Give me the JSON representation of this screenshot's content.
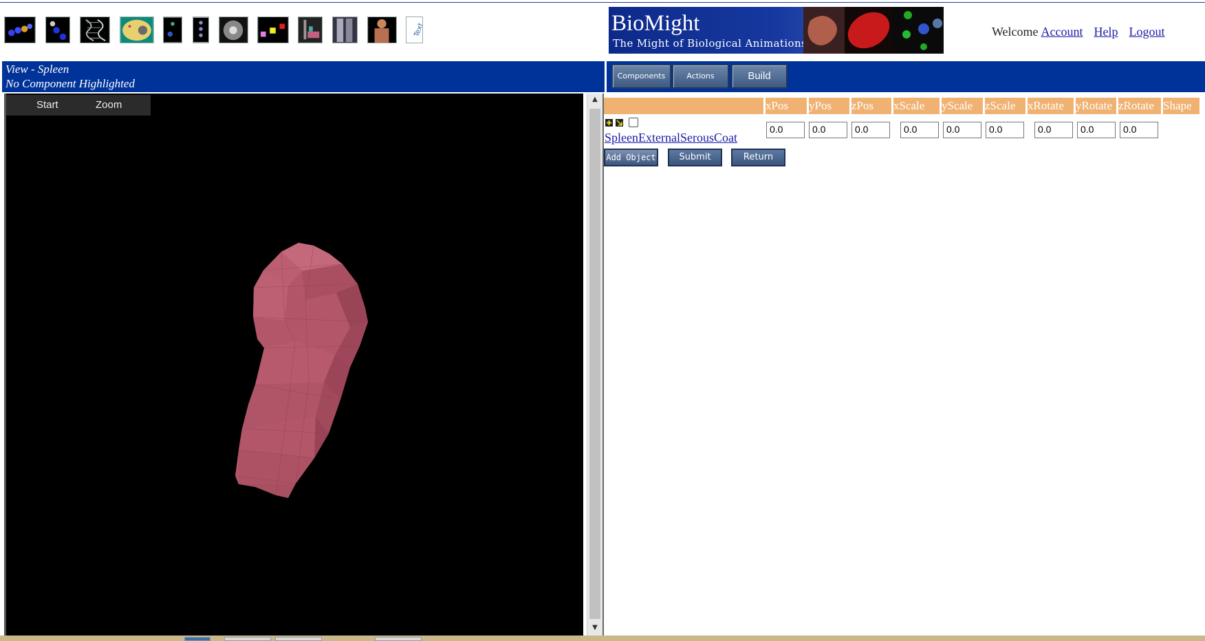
{
  "toolbar": {
    "icons": [
      {
        "name": "molecule-chain-icon"
      },
      {
        "name": "blue-cells-icon"
      },
      {
        "name": "dna-helix-icon"
      },
      {
        "name": "cell-icon"
      },
      {
        "name": "small-cells-icon"
      },
      {
        "name": "bead-chain-icon"
      },
      {
        "name": "sphere-icon"
      },
      {
        "name": "colored-blocks-icon"
      },
      {
        "name": "figure-icon"
      },
      {
        "name": "skeleton-icon"
      },
      {
        "name": "human-body-icon"
      },
      {
        "name": "text-icon",
        "label": "Text"
      }
    ]
  },
  "banner": {
    "title": "BioMight",
    "subtitle": "The Might of Biological Animations"
  },
  "user_nav": {
    "welcome": "Welcome",
    "account": "Account",
    "help": "Help",
    "logout": "Logout"
  },
  "view_info": {
    "title": "View - Spleen",
    "highlight": "No Component Highlighted"
  },
  "action_buttons": {
    "components": "Components",
    "actions": "Actions",
    "build": "Build"
  },
  "viewer": {
    "menu_start": "Start",
    "menu_zoom": "Zoom"
  },
  "table": {
    "columns": [
      "xPos",
      "yPos",
      "zPos",
      "xScale",
      "yScale",
      "zScale",
      "xRotate",
      "yRotate",
      "zRotate",
      "Shape"
    ],
    "row": {
      "component": "SpleenExternalSerousCoat",
      "values": [
        "0.0",
        "0.0",
        "0.0",
        "0.0",
        "0.0",
        "0.0",
        "0.0",
        "0.0",
        "0.0"
      ]
    }
  },
  "form_buttons": {
    "add_object": "Add Object",
    "submit": "Submit",
    "return": "Return"
  },
  "colors": {
    "nav_blue": "#003399",
    "header_orange": "#efb272",
    "spleen": "#b4566a"
  }
}
